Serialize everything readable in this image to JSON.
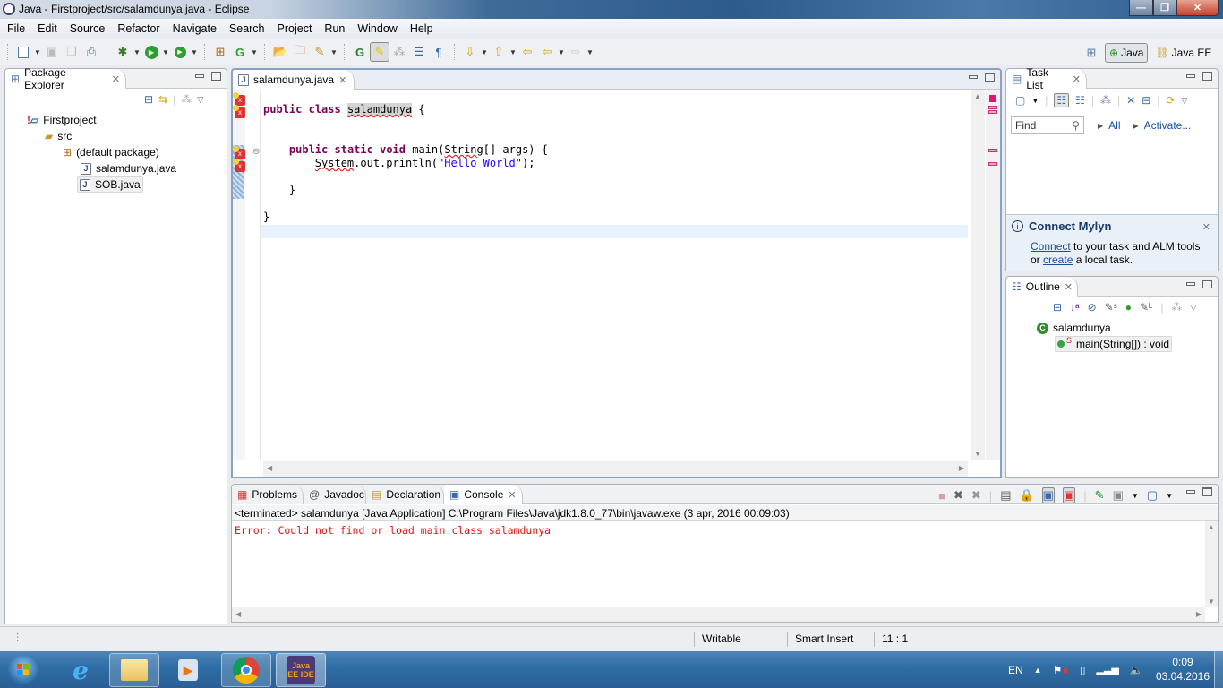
{
  "window": {
    "title": "Java - Firstproject/src/salamdunya.java - Eclipse",
    "controls": {
      "minimize": "—",
      "maximize": "❐",
      "close": "✕"
    }
  },
  "menu": [
    "File",
    "Edit",
    "Source",
    "Refactor",
    "Navigate",
    "Search",
    "Project",
    "Run",
    "Window",
    "Help"
  ],
  "toolbar": {
    "icons": [
      "new-wizard-icon",
      "save-icon",
      "save-all-icon",
      "print-icon",
      "debug-icon",
      "run-icon",
      "run-external-tools-icon",
      "new-java-package-icon",
      "new-java-class-icon",
      "open-type-icon",
      "open-task-icon",
      "search-icon",
      "toggle-breadcrumb-icon",
      "toggle-mark-occurrences-icon",
      "toggle-block-selection-icon",
      "show-whitespace-icon",
      "show-paragraph-icon",
      "next-annotation-icon",
      "previous-annotation-icon",
      "last-edit-location-icon",
      "back-icon",
      "forward-icon"
    ]
  },
  "perspectives": {
    "open_perspective_icon": "open-perspective-icon",
    "items": [
      {
        "label": "Java",
        "active": true
      },
      {
        "label": "Java EE",
        "active": false
      }
    ]
  },
  "package_explorer": {
    "tab_label": "Package Explorer",
    "tree": [
      {
        "label": "Firstproject",
        "icon": "project-error-icon",
        "level": 0
      },
      {
        "label": "src",
        "icon": "source-folder-icon",
        "level": 1
      },
      {
        "label": "(default package)",
        "icon": "package-icon",
        "level": 2
      },
      {
        "label": "salamdunya.java",
        "icon": "java-file-icon",
        "level": 3
      },
      {
        "label": "SOB.java",
        "icon": "java-file-icon",
        "level": 3,
        "selected": true
      }
    ]
  },
  "editor": {
    "tab_label": "salamdunya.java",
    "code_lines": [
      {
        "indent": "",
        "parts": [
          {
            "t": "public",
            "c": "kw"
          },
          {
            "t": " "
          },
          {
            "t": "class",
            "c": "kw"
          },
          {
            "t": " "
          },
          {
            "t": "salamdunya",
            "c": "err sel"
          },
          {
            "t": " {"
          }
        ]
      },
      {
        "indent": "",
        "parts": []
      },
      {
        "indent": "",
        "parts": []
      },
      {
        "indent": "    ",
        "parts": [
          {
            "t": "public",
            "c": "kw"
          },
          {
            "t": " "
          },
          {
            "t": "static",
            "c": "kw"
          },
          {
            "t": " "
          },
          {
            "t": "void",
            "c": "kw"
          },
          {
            "t": " main("
          },
          {
            "t": "String",
            "c": "err"
          },
          {
            "t": "[] args) {"
          }
        ]
      },
      {
        "indent": "        ",
        "parts": [
          {
            "t": "System",
            "c": "err"
          },
          {
            "t": ".out.println("
          },
          {
            "t": "\"Hello World\"",
            "c": "str"
          },
          {
            "t": ");"
          }
        ]
      },
      {
        "indent": "",
        "parts": []
      },
      {
        "indent": "    ",
        "parts": [
          {
            "t": "}"
          }
        ]
      },
      {
        "indent": "",
        "parts": []
      },
      {
        "indent": "",
        "parts": [
          {
            "t": "}"
          }
        ]
      }
    ],
    "cursor_line_note": "line 11"
  },
  "task_list": {
    "tab_label": "Task List",
    "find_placeholder": "Find",
    "all_label": "All",
    "activate_label": "Activate...",
    "mylyn": {
      "title": "Connect Mylyn",
      "connect_link": "Connect",
      "text1": " to your task and ALM tools",
      "or": "or ",
      "create_link": "create",
      "text2": " a local task."
    }
  },
  "outline": {
    "tab_label": "Outline",
    "items": [
      {
        "label": "salamdunya",
        "icon": "class-icon",
        "level": 0
      },
      {
        "label": "main(String[]) : void",
        "icon": "public-method-icon",
        "modifier": "S",
        "level": 1,
        "selected": true
      }
    ]
  },
  "bottom_panel": {
    "tabs": [
      {
        "label": "Problems",
        "icon": "problems-icon"
      },
      {
        "label": "Javadoc",
        "icon": "at-icon"
      },
      {
        "label": "Declaration",
        "icon": "declaration-icon"
      },
      {
        "label": "Console",
        "icon": "console-icon",
        "active": true
      }
    ],
    "console_header": "<terminated> salamdunya [Java Application] C:\\Program Files\\Java\\jdk1.8.0_77\\bin\\javaw.exe (3 apr, 2016 00:09:03)",
    "console_output": "Error: Could not find or load main class salamdunya"
  },
  "status_bar": {
    "writable": "Writable",
    "insert_mode": "Smart Insert",
    "position": "11 : 1"
  },
  "taskbar": {
    "apps": [
      "start-button",
      "internet-explorer",
      "windows-explorer",
      "media-player",
      "chrome",
      "java-ee-ide"
    ],
    "java_ee_label": "Java EE IDE",
    "tray_language": "EN",
    "time": "0:09",
    "date": "03.04.2016"
  },
  "colors": {
    "keyword": "#7f0055",
    "string": "#2a00ff",
    "error": "#e21313",
    "link": "#1a4fa0"
  }
}
